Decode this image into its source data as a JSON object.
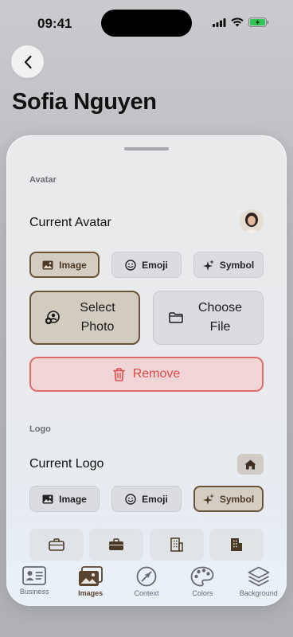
{
  "status": {
    "time": "09:41"
  },
  "page": {
    "title": "Sofia Nguyen"
  },
  "avatar_section": {
    "label": "Avatar",
    "row_label": "Current Avatar",
    "segments": [
      "Image",
      "Emoji",
      "Symbol"
    ],
    "selected_segment": "Image",
    "actions": {
      "select_photo": "Select Photo",
      "choose_file": "Choose File"
    },
    "remove_label": "Remove"
  },
  "logo_section": {
    "label": "Logo",
    "row_label": "Current Logo",
    "segments": [
      "Image",
      "Emoji",
      "Symbol"
    ],
    "selected_segment": "Symbol",
    "symbols": [
      "briefcase-outline-icon",
      "briefcase-fill-icon",
      "building-outline-icon",
      "building-fill-icon"
    ]
  },
  "tabs": [
    {
      "label": "Business",
      "icon": "person-card-icon"
    },
    {
      "label": "Images",
      "icon": "photos-icon",
      "active": true
    },
    {
      "label": "Context",
      "icon": "compass-arrow-icon"
    },
    {
      "label": "Colors",
      "icon": "palette-icon"
    },
    {
      "label": "Background",
      "icon": "layers-icon"
    }
  ],
  "colors": {
    "accent": "#6a5437",
    "destructive": "#dc4a4a"
  }
}
